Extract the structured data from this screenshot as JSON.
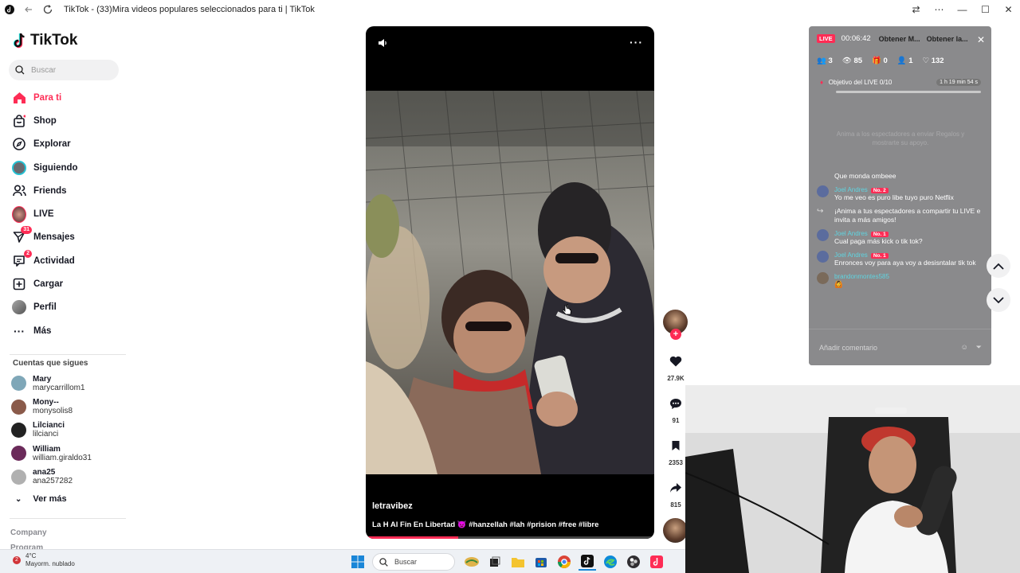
{
  "window": {
    "title": "TikTok - (33)Mira videos populares seleccionados para ti | TikTok",
    "controls": [
      "minimize-icon",
      "maximize-icon",
      "close-icon"
    ]
  },
  "sidebar": {
    "logo": "TikTok",
    "search_placeholder": "Buscar",
    "nav": [
      {
        "label": "Para ti",
        "icon": "home-icon",
        "active": true
      },
      {
        "label": "Shop",
        "icon": "shop-icon"
      },
      {
        "label": "Explorar",
        "icon": "compass-icon"
      },
      {
        "label": "Siguiendo",
        "icon": "following-avatar-icon"
      },
      {
        "label": "Friends",
        "icon": "friends-icon"
      },
      {
        "label": "LIVE",
        "icon": "live-avatar-icon"
      },
      {
        "label": "Mensajes",
        "icon": "messages-icon",
        "badge": "31"
      },
      {
        "label": "Actividad",
        "icon": "activity-icon",
        "badge": "2"
      },
      {
        "label": "Cargar",
        "icon": "upload-icon"
      },
      {
        "label": "Perfil",
        "icon": "profile-avatar-icon"
      },
      {
        "label": "Más",
        "icon": "more-icon"
      }
    ],
    "following_title": "Cuentas que sigues",
    "following": [
      {
        "name": "Mary",
        "handle": "marycarrillom1",
        "color": "#7fa7b8"
      },
      {
        "name": "Mony--",
        "handle": "monysolis8",
        "color": "#8a5a4a"
      },
      {
        "name": "Lilcianci",
        "handle": "lilcianci",
        "color": "#222222"
      },
      {
        "name": "William",
        "handle": "william.giraldo31",
        "color": "#6b2a5a"
      },
      {
        "name": "ana25",
        "handle": "ana257282",
        "color": "#b0b0b0"
      }
    ],
    "see_more": "Ver más",
    "footer_company": "Company",
    "footer_program": "Program"
  },
  "video": {
    "author": "letravibez",
    "caption": "La H Al Fin En Libertad 👿 #hanzellah #lah #prision #free #libre",
    "progress": 0.32
  },
  "actions": {
    "likes": "27.9K",
    "comments": "91",
    "saves": "2353",
    "shares": "815"
  },
  "live": {
    "badge": "LIVE",
    "time": "00:06:42",
    "chip1": "Obtener M...",
    "chip2": "Obtener la...",
    "stats": {
      "viewers": "3",
      "views": "85",
      "gifts": "0",
      "shares": "1",
      "likes": "132"
    },
    "goal_label": "Objetivo del LIVE",
    "goal_value": "0/10",
    "goal_timer": "1 h 19 min 54 s",
    "hint": "Anima a los espectadores a enviar Regalos y mostrarte su apoyo.",
    "messages": [
      {
        "name": "",
        "tag": "",
        "text": "Que monda ombeee"
      },
      {
        "name": "Joel Andres",
        "tag": "No. 2",
        "text": "Yo me veo es puro libe tuyo puro Netflix"
      },
      {
        "name": "",
        "tag": "",
        "text": "¡Anima a tus espectadores a compartir tu LIVE e invita a más amigos!",
        "system": true
      },
      {
        "name": "Joel Andres",
        "tag": "No. 1",
        "text": "Cual paga más kick o tik tok?"
      },
      {
        "name": "Joel Andres",
        "tag": "No. 1",
        "text": "Enronces voy para aya voy a desisntalar tik tok"
      },
      {
        "name": "brandonmontes585",
        "tag": "",
        "text": "🙆"
      }
    ],
    "comment_placeholder": "Añadir comentario"
  },
  "taskbar": {
    "weather_temp": "4°C",
    "weather_desc": "Mayorm. nublado",
    "weather_badge": "2",
    "search": "Buscar"
  }
}
